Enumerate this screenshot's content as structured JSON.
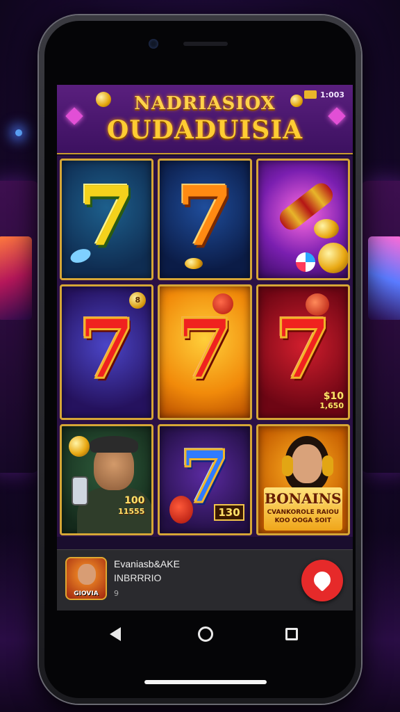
{
  "header": {
    "title_line1": "NADRIASIOX",
    "title_line2": "OUDADUISIA",
    "status_time": "1:003"
  },
  "tiles": [
    {
      "kind": "seven",
      "color": "yellow"
    },
    {
      "kind": "seven",
      "color": "orange"
    },
    {
      "kind": "coins",
      "color": "purple"
    },
    {
      "kind": "seven",
      "color": "red",
      "badge": "8"
    },
    {
      "kind": "seven",
      "color": "red"
    },
    {
      "kind": "seven",
      "color": "red",
      "price_line1": "$10",
      "price_line2": "1,650"
    },
    {
      "kind": "person",
      "text_line1": "100",
      "text_line2": "11555"
    },
    {
      "kind": "seven",
      "color": "blue",
      "text": "130"
    },
    {
      "kind": "bonus",
      "title": "BONAINS",
      "sub_line1": "CVANKOROLE RAIOU",
      "sub_line2": "KOO OOGA SOIT"
    }
  ],
  "seven_glyph": "7",
  "app_bar": {
    "app_name": "Evaniasb&AKE",
    "app_sub": "INBRRRIO",
    "app_meta": "9",
    "icon_label": "GIOVIA"
  },
  "colors": {
    "accent_gold": "#d6a636",
    "button_red": "#e62a2a"
  }
}
